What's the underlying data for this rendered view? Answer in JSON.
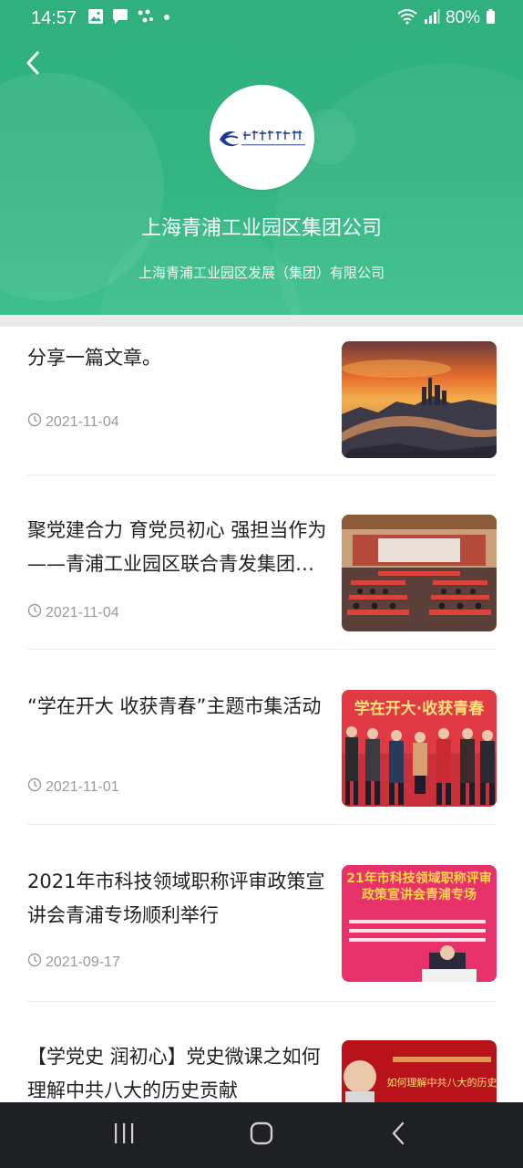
{
  "status_bar": {
    "time": "14:57",
    "battery": "80%",
    "icons": [
      "image-icon",
      "chat-icon",
      "dots-icon",
      "dot-icon",
      "wifi-icon",
      "signal-icon",
      "battery-icon"
    ]
  },
  "header": {
    "back_icon": "chevron-left-icon",
    "logo": "company-logo",
    "title": "上海青浦工业园区集团公司",
    "subtitle": "上海青浦工业园区发展（集团）有限公司",
    "colors": {
      "green_top": "#2fb07e",
      "green_bottom": "#3cbf8b"
    }
  },
  "articles": [
    {
      "title": "分享一篇文章。",
      "date": "2021-11-04",
      "image": "city-sunset-photo"
    },
    {
      "title": "聚党建合力 育党员初心 强担当作为——青浦工业园区联合青发集团…",
      "date": "2021-11-04",
      "image": "meeting-hall-photo"
    },
    {
      "title": "“学在开大 收获青春”主题市集活动",
      "date": "2021-11-01",
      "image": "group-photo",
      "image_text": "学在开大·收获青春"
    },
    {
      "title": "2021年市科技领域职称评审政策宣讲会青浦专场顺利举行",
      "date": "2021-09-17",
      "image": "conference-banner-photo",
      "image_text": "21年市科技领域职称评审政策宣讲会青浦专场"
    },
    {
      "title": "【学党史  润初心】党史微课之如何理解中共八大的历史贡献",
      "date": "",
      "image": "lecture-photo",
      "image_text": "如何理解中共八大的历史"
    }
  ],
  "nav_bar": {
    "buttons": [
      "recent-apps-icon",
      "home-icon",
      "back-icon"
    ]
  }
}
